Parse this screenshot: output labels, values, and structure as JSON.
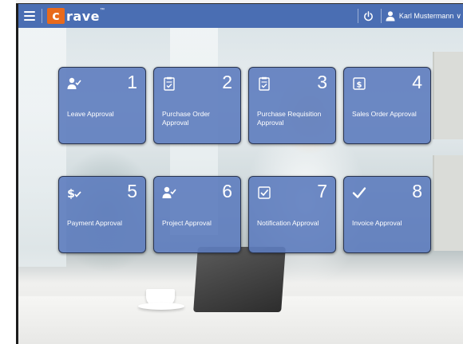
{
  "app": {
    "logo_letter": "c",
    "logo_rest": "rave",
    "logo_mark": "™",
    "user_name": "Karl Mustermann",
    "user_caret": "∨"
  },
  "icons": {
    "menu": "hamburger-menu-icon",
    "power": "power-icon",
    "user": "user-icon"
  },
  "colors": {
    "appbar": "#4a6eb3",
    "tile": "#5d7cbe",
    "logo_accent": "#e86a1c"
  },
  "tiles": [
    {
      "number": "1",
      "label": "Leave Approval",
      "icon": "person-check-icon"
    },
    {
      "number": "2",
      "label": "Purchase Order Approval",
      "icon": "clipboard-check-icon"
    },
    {
      "number": "3",
      "label": "Purchase Requisition Approval",
      "icon": "clipboard-check-icon"
    },
    {
      "number": "4",
      "label": "Sales Order Approval",
      "icon": "dollar-document-icon"
    },
    {
      "number": "5",
      "label": "Payment Approval",
      "icon": "dollar-check-icon"
    },
    {
      "number": "6",
      "label": "Project Approval",
      "icon": "person-check-icon"
    },
    {
      "number": "7",
      "label": "Notification Approval",
      "icon": "checkbox-icon"
    },
    {
      "number": "8",
      "label": "Invoice Approval",
      "icon": "checkmark-icon"
    }
  ]
}
